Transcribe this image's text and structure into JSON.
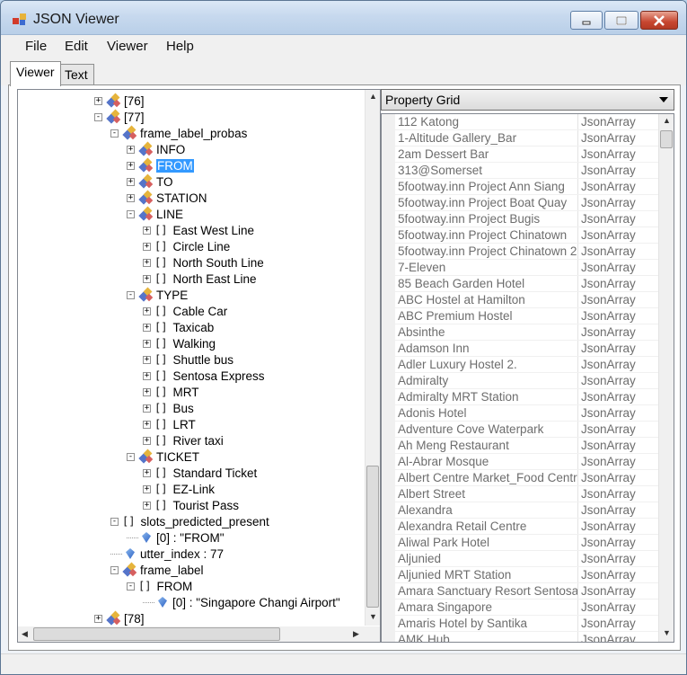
{
  "window": {
    "title": "JSON Viewer"
  },
  "menu": [
    "File",
    "Edit",
    "Viewer",
    "Help"
  ],
  "tabs": [
    "Viewer",
    "Text"
  ],
  "tree": [
    {
      "label": "[76]",
      "type": "object",
      "expander": "+",
      "indent": 0
    },
    {
      "label": "[77]",
      "type": "object",
      "expander": "-",
      "indent": 0
    },
    {
      "label": "frame_label_probas",
      "type": "object",
      "expander": "-",
      "indent": 1
    },
    {
      "label": "INFO",
      "type": "object",
      "expander": "+",
      "indent": 2
    },
    {
      "label": "FROM",
      "type": "object",
      "expander": "+",
      "indent": 2,
      "selected": true
    },
    {
      "label": "TO",
      "type": "object",
      "expander": "+",
      "indent": 2
    },
    {
      "label": "STATION",
      "type": "object",
      "expander": "+",
      "indent": 2
    },
    {
      "label": "LINE",
      "type": "object",
      "expander": "-",
      "indent": 2
    },
    {
      "label": "East West Line",
      "type": "array",
      "expander": "+",
      "indent": 3
    },
    {
      "label": "Circle Line",
      "type": "array",
      "expander": "+",
      "indent": 3
    },
    {
      "label": "North South Line",
      "type": "array",
      "expander": "+",
      "indent": 3
    },
    {
      "label": "North East Line",
      "type": "array",
      "expander": "+",
      "indent": 3
    },
    {
      "label": "TYPE",
      "type": "object",
      "expander": "-",
      "indent": 2
    },
    {
      "label": "Cable Car",
      "type": "array",
      "expander": "+",
      "indent": 3
    },
    {
      "label": "Taxicab",
      "type": "array",
      "expander": "+",
      "indent": 3
    },
    {
      "label": "Walking",
      "type": "array",
      "expander": "+",
      "indent": 3
    },
    {
      "label": "Shuttle bus",
      "type": "array",
      "expander": "+",
      "indent": 3
    },
    {
      "label": "Sentosa Express",
      "type": "array",
      "expander": "+",
      "indent": 3
    },
    {
      "label": "MRT",
      "type": "array",
      "expander": "+",
      "indent": 3
    },
    {
      "label": "Bus",
      "type": "array",
      "expander": "+",
      "indent": 3
    },
    {
      "label": "LRT",
      "type": "array",
      "expander": "+",
      "indent": 3
    },
    {
      "label": "River taxi",
      "type": "array",
      "expander": "+",
      "indent": 3
    },
    {
      "label": "TICKET",
      "type": "object",
      "expander": "-",
      "indent": 2
    },
    {
      "label": "Standard Ticket",
      "type": "array",
      "expander": "+",
      "indent": 3
    },
    {
      "label": "EZ-Link",
      "type": "array",
      "expander": "+",
      "indent": 3
    },
    {
      "label": "Tourist Pass",
      "type": "array",
      "expander": "+",
      "indent": 3
    },
    {
      "label": "slots_predicted_present",
      "type": "array",
      "expander": "-",
      "indent": 1
    },
    {
      "label": "[0] : \"FROM\"",
      "type": "value",
      "expander": "",
      "indent": 2
    },
    {
      "label": "utter_index : 77",
      "type": "value",
      "expander": "",
      "indent": 1
    },
    {
      "label": "frame_label",
      "type": "object",
      "expander": "-",
      "indent": 1
    },
    {
      "label": "FROM",
      "type": "array",
      "expander": "-",
      "indent": 2
    },
    {
      "label": "[0] : \"Singapore Changi Airport\"",
      "type": "value",
      "expander": "",
      "indent": 3
    },
    {
      "label": "[78]",
      "type": "object",
      "expander": "+",
      "indent": 0
    }
  ],
  "property_grid": {
    "combo_label": "Property Grid",
    "rows": [
      {
        "name": "112 Katong",
        "value": "JsonArray"
      },
      {
        "name": "1-Altitude Gallery_Bar",
        "value": "JsonArray"
      },
      {
        "name": "2am Dessert Bar",
        "value": "JsonArray"
      },
      {
        "name": "313@Somerset",
        "value": "JsonArray"
      },
      {
        "name": "5footway.inn Project Ann Siang",
        "value": "JsonArray"
      },
      {
        "name": "5footway.inn Project Boat Quay",
        "value": "JsonArray"
      },
      {
        "name": "5footway.inn Project Bugis",
        "value": "JsonArray"
      },
      {
        "name": "5footway.inn Project Chinatown",
        "value": "JsonArray"
      },
      {
        "name": "5footway.inn Project Chinatown 2",
        "value": "JsonArray"
      },
      {
        "name": "7-Eleven",
        "value": "JsonArray"
      },
      {
        "name": "85 Beach Garden Hotel",
        "value": "JsonArray"
      },
      {
        "name": "ABC Hostel at Hamilton",
        "value": "JsonArray"
      },
      {
        "name": "ABC Premium Hostel",
        "value": "JsonArray"
      },
      {
        "name": "Absinthe",
        "value": "JsonArray"
      },
      {
        "name": "Adamson Inn",
        "value": "JsonArray"
      },
      {
        "name": "Adler Luxury Hostel 2.",
        "value": "JsonArray"
      },
      {
        "name": "Admiralty",
        "value": "JsonArray"
      },
      {
        "name": "Admiralty MRT Station",
        "value": "JsonArray"
      },
      {
        "name": "Adonis Hotel",
        "value": "JsonArray"
      },
      {
        "name": "Adventure Cove Waterpark",
        "value": "JsonArray"
      },
      {
        "name": "Ah Meng Restaurant",
        "value": "JsonArray"
      },
      {
        "name": "Al-Abrar Mosque",
        "value": "JsonArray"
      },
      {
        "name": "Albert Centre Market_Food Centre",
        "value": "JsonArray"
      },
      {
        "name": "Albert Street",
        "value": "JsonArray"
      },
      {
        "name": "Alexandra",
        "value": "JsonArray"
      },
      {
        "name": "Alexandra Retail Centre",
        "value": "JsonArray"
      },
      {
        "name": "Aliwal Park Hotel",
        "value": "JsonArray"
      },
      {
        "name": "Aljunied",
        "value": "JsonArray"
      },
      {
        "name": "Aljunied MRT Station",
        "value": "JsonArray"
      },
      {
        "name": "Amara Sanctuary Resort Sentosa",
        "value": "JsonArray"
      },
      {
        "name": "Amara Singapore",
        "value": "JsonArray"
      },
      {
        "name": "Amaris Hotel by Santika",
        "value": "JsonArray"
      },
      {
        "name": "AMK Hub",
        "value": "JsonArray"
      }
    ]
  }
}
